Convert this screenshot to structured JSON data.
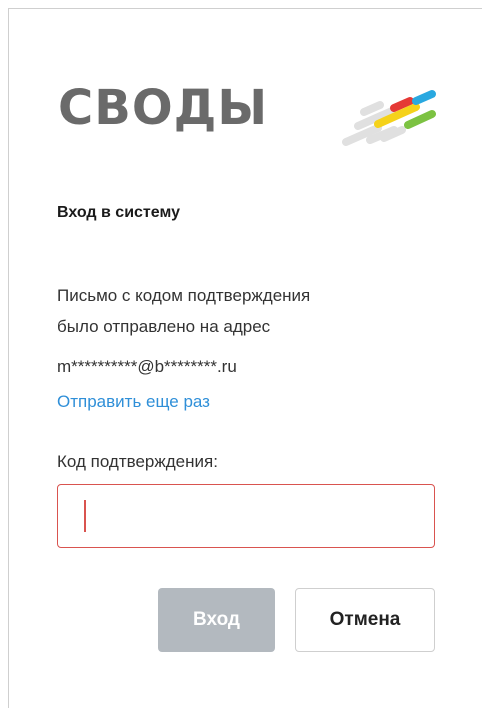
{
  "logo": {
    "text": "СВОДЫ",
    "colors": {
      "text": "#6a6a6a",
      "stripe_gray": "#e0e0e0",
      "red": "#e53935",
      "blue": "#29a8e0",
      "yellow": "#f5d21a",
      "green": "#7cc242"
    }
  },
  "form": {
    "title": "Вход в систему",
    "info_line1": "Письмо с кодом подтверждения",
    "info_line2": "было отправлено на адрес",
    "email": "m**********@b********.ru",
    "resend_label": "Отправить еще раз",
    "code_label": "Код подтверждения:",
    "code_value": "",
    "code_placeholder": ""
  },
  "buttons": {
    "login_label": "Вход",
    "cancel_label": "Отмена"
  },
  "colors": {
    "accent_link": "#2f8fd8",
    "error_border": "#d9534f",
    "disabled_button": "#b3b9bf"
  }
}
